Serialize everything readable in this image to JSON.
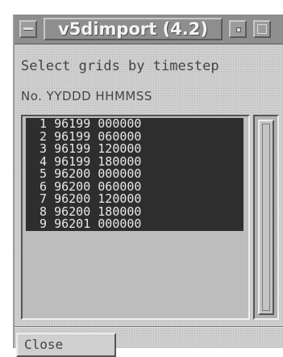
{
  "window": {
    "title": "v5dimport (4.2)"
  },
  "body": {
    "heading": "Select grids by timestep",
    "column_header": "No. YYDDD HHMMSS"
  },
  "list": {
    "rows": [
      {
        "no": "1",
        "yyddd": "96199",
        "hhmmss": "000000",
        "text": " 1 96199 000000"
      },
      {
        "no": "2",
        "yyddd": "96199",
        "hhmmss": "060000",
        "text": " 2 96199 060000"
      },
      {
        "no": "3",
        "yyddd": "96199",
        "hhmmss": "120000",
        "text": " 3 96199 120000"
      },
      {
        "no": "4",
        "yyddd": "96199",
        "hhmmss": "180000",
        "text": " 4 96199 180000"
      },
      {
        "no": "5",
        "yyddd": "96200",
        "hhmmss": "000000",
        "text": " 5 96200 000000"
      },
      {
        "no": "6",
        "yyddd": "96200",
        "hhmmss": "060000",
        "text": " 6 96200 060000"
      },
      {
        "no": "7",
        "yyddd": "96200",
        "hhmmss": "120000",
        "text": " 7 96200 120000"
      },
      {
        "no": "8",
        "yyddd": "96200",
        "hhmmss": "180000",
        "text": " 8 96200 180000"
      },
      {
        "no": "9",
        "yyddd": "96201",
        "hhmmss": "000000",
        "text": " 9 96201 000000"
      }
    ],
    "selected_count": 9
  },
  "buttons": {
    "close_label": "Close"
  },
  "icons": {
    "window_menu": "window-menu-icon",
    "minimize": "minimize-icon",
    "maximize": "maximize-icon"
  },
  "colors": {
    "selection_bg": "#2e2e2e",
    "selection_fg": "#e8e8e8",
    "titlebar": "#8e8e8e"
  }
}
